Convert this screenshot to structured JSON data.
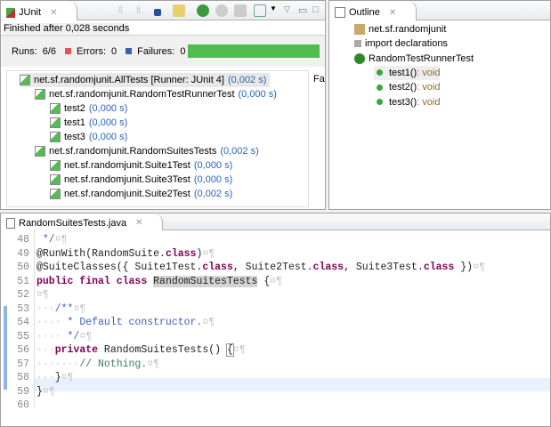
{
  "junit": {
    "tab_label": "JUnit",
    "status": "Finished after 0,028 seconds",
    "runs_label": "Runs:",
    "runs_value": "6/6",
    "errors_label": "Errors:",
    "errors_value": "0",
    "failures_label": "Failures:",
    "failures_value": "0",
    "progress": 1.0,
    "trace_label": "Fa",
    "tree": [
      {
        "label": "net.sf.randomjunit.AllTests [Runner: JUnit 4]",
        "time": "(0,002 s)",
        "level": 0
      },
      {
        "label": "net.sf.randomjunit.RandomTestRunnerTest",
        "time": "(0,000 s)",
        "level": 1
      },
      {
        "label": "test2",
        "time": "(0,000 s)",
        "level": 2
      },
      {
        "label": "test1",
        "time": "(0,000 s)",
        "level": 2
      },
      {
        "label": "test3",
        "time": "(0,000 s)",
        "level": 2
      },
      {
        "label": "net.sf.randomjunit.RandomSuitesTests",
        "time": "(0,002 s)",
        "level": 1
      },
      {
        "label": "net.sf.randomjunit.Suite1Test",
        "time": "(0,000 s)",
        "level": 2
      },
      {
        "label": "net.sf.randomjunit.Suite3Test",
        "time": "(0,000 s)",
        "level": 2
      },
      {
        "label": "net.sf.randomjunit.Suite2Test",
        "time": "(0,002 s)",
        "level": 2
      }
    ]
  },
  "outline": {
    "tab_label": "Outline",
    "items": [
      {
        "label": "net.sf.randomjunit",
        "type": "",
        "icon": "package-icon",
        "level": 0
      },
      {
        "label": "import declarations",
        "type": "",
        "icon": "imports-icon",
        "level": 0
      },
      {
        "label": "RandomTestRunnerTest",
        "type": "",
        "icon": "class-icon",
        "level": 0
      },
      {
        "label": "test1()",
        "type": " : void",
        "icon": "method-icon",
        "level": 1
      },
      {
        "label": "test2()",
        "type": " : void",
        "icon": "method-icon",
        "level": 1
      },
      {
        "label": "test3()",
        "type": " : void",
        "icon": "method-icon",
        "level": 1
      }
    ]
  },
  "editor": {
    "tab_label": "RandomSuitesTests.java",
    "lines": [
      {
        "n": "48",
        "html": "<span class='cm'> */</span><span class='ws'>¤¶</span>"
      },
      {
        "n": "49",
        "html": "@RunWith(RandomSuite.<span class='kw'>class</span>)<span class='ws'>¤¶</span>"
      },
      {
        "n": "50",
        "html": "@SuiteClasses({ Suite1Test.<span class='kw'>class</span>, Suite2Test.<span class='kw'>class</span>, Suite3Test.<span class='kw'>class</span> })<span class='ws'>¤¶</span>"
      },
      {
        "n": "51",
        "html": "<span class='kw'>public final class</span> <span style='background:#d4d4d4'>RandomSuitesTests</span> {<span class='ws'>¤¶</span>"
      },
      {
        "n": "52",
        "html": "<span class='ws'>¤¶</span>"
      },
      {
        "n": "53",
        "html": "<span class='ws'>···</span><span class='cm'>/**</span><span class='ws'>¤¶</span>"
      },
      {
        "n": "54",
        "html": "<span class='ws'>····</span><span class='cm'> * Default constructor.</span><span class='ws'>¤¶</span>"
      },
      {
        "n": "55",
        "html": "<span class='ws'>····</span><span class='cm'> */</span><span class='ws'>¤¶</span>"
      },
      {
        "n": "56",
        "html": "<span class='ws'>···</span><span class='kw'>private</span> RandomSuitesTests() <span style='outline:1px solid #999'>{</span><span class='ws'>¤¶</span>"
      },
      {
        "n": "57",
        "html": "<span class='ws'>·······</span><span style='color:#3f7f5f'>// Nothing.</span><span class='ws'>¤¶</span>"
      },
      {
        "n": "58",
        "html": "<span class='ws'>···</span>}<span class='ws'>¤¶</span>"
      },
      {
        "n": "59",
        "html": "}<span class='ws'>¤¶</span>"
      },
      {
        "n": "60",
        "html": ""
      }
    ]
  }
}
